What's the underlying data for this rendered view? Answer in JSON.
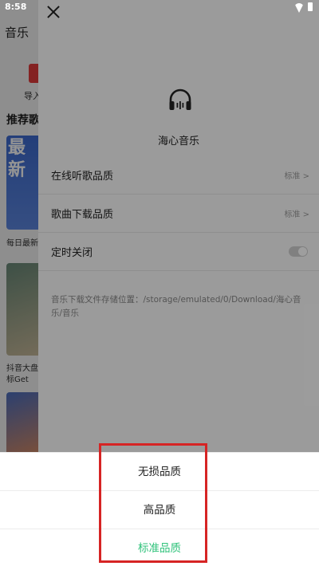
{
  "status_bar": {
    "time": "8:58"
  },
  "background_app": {
    "title": "音乐",
    "import_label": "导入",
    "recommend_heading": "推荐歌",
    "card1_big_text": "最新",
    "card1_caption": "每日最新",
    "card2_caption_line1": "抖音大盘",
    "card2_caption_line2": "标Get"
  },
  "settings": {
    "app_name": "海心音乐",
    "rows": [
      {
        "label": "在线听歌品质",
        "value": "标准 >"
      },
      {
        "label": "歌曲下载品质",
        "value": "标准 >"
      },
      {
        "label": "定时关闭",
        "toggle": false
      }
    ],
    "storage_path": "音乐下载文件存储位置：/storage/emulated/0/Download/海心音乐/音乐"
  },
  "quality_sheet": {
    "options": [
      {
        "label": "无损品质",
        "selected": false
      },
      {
        "label": "高品质",
        "selected": false
      },
      {
        "label": "标准品质",
        "selected": true
      }
    ],
    "selected_color": "#2ec27a",
    "highlight_color": "#d62424"
  }
}
